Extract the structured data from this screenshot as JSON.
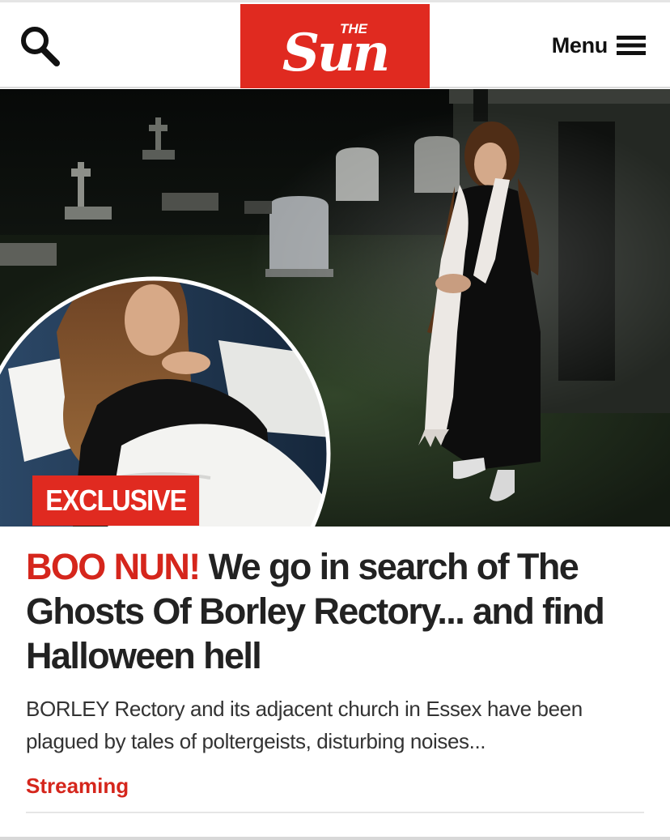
{
  "header": {
    "logo_small": "THE",
    "logo_main": "Sun",
    "menu_label": "Menu",
    "brand_color": "#e02a20"
  },
  "icons": {
    "search": "search-icon",
    "menu": "hamburger-icon"
  },
  "article": {
    "label": "EXCLUSIVE",
    "kicker": "BOO NUN!",
    "headline": " We go in search of The Ghosts Of Borley Rectory... and find Halloween hell",
    "standfirst": "BORLEY Rectory and its adjacent church in Essex have been plagued by tales of poltergeists, disturbing noises...",
    "section_tag": "Streaming",
    "accent_color": "#d5261c"
  }
}
